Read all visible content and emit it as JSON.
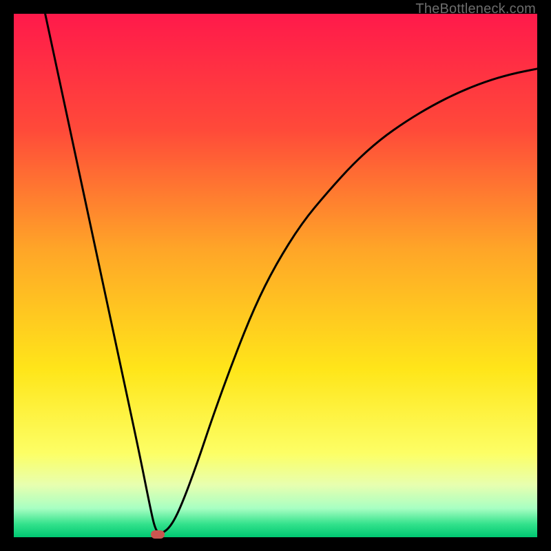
{
  "watermark": "TheBottleneck.com",
  "chart_data": {
    "type": "line",
    "title": "",
    "xlabel": "",
    "ylabel": "",
    "xlim": [
      0,
      100
    ],
    "ylim": [
      0,
      100
    ],
    "grid": false,
    "legend": false,
    "background_gradient": {
      "stops": [
        {
          "t": 0.0,
          "color": "#ff1a4b"
        },
        {
          "t": 0.22,
          "color": "#ff4a3a"
        },
        {
          "t": 0.45,
          "color": "#ffa628"
        },
        {
          "t": 0.68,
          "color": "#ffe61a"
        },
        {
          "t": 0.84,
          "color": "#fdff66"
        },
        {
          "t": 0.9,
          "color": "#e8ffb0"
        },
        {
          "t": 0.945,
          "color": "#a8ffc3"
        },
        {
          "t": 0.975,
          "color": "#33e28c"
        },
        {
          "t": 1.0,
          "color": "#00c872"
        }
      ]
    },
    "series": [
      {
        "name": "bottleneck-curve",
        "color": "#000000",
        "x": [
          6,
          9,
          12,
          15,
          18,
          21,
          24,
          26,
          27,
          28,
          30,
          32,
          35,
          38,
          42,
          46,
          50,
          55,
          60,
          65,
          70,
          75,
          80,
          85,
          90,
          95,
          100
        ],
        "y": [
          100,
          86,
          72,
          58,
          44,
          30,
          16,
          6,
          1.5,
          0.5,
          2,
          6,
          14,
          23,
          34,
          44,
          52,
          60,
          66,
          71.5,
          76,
          79.5,
          82.5,
          85,
          87,
          88.5,
          89.5
        ]
      }
    ],
    "marker": {
      "name": "optimal-point",
      "x": 27.5,
      "y": 0.5,
      "color": "#cb5650"
    }
  }
}
